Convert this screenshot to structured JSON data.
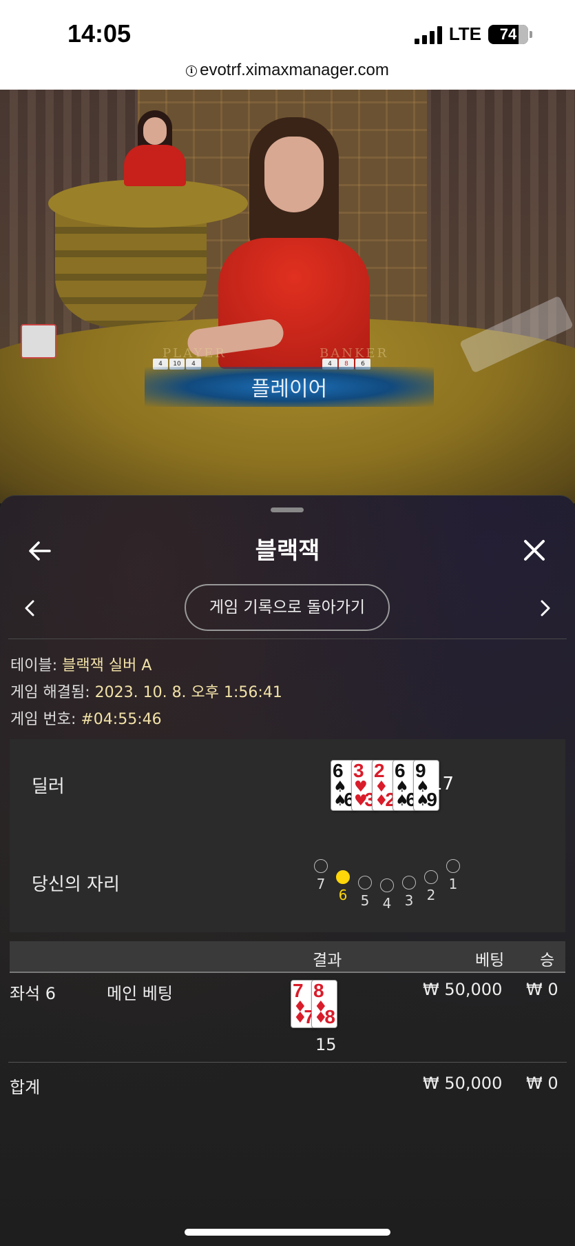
{
  "status_bar": {
    "time": "14:05",
    "network": "LTE",
    "battery": "74"
  },
  "browser": {
    "url": "evotrf.ximaxmanager.com"
  },
  "video": {
    "player_label": "PLAYER",
    "banker_label": "BANKER",
    "result_banner": "플레이어"
  },
  "panel": {
    "title": "블랙잭",
    "history_button": "게임 기록으로 돌아가기",
    "info": {
      "table_label": "테이블: ",
      "table_value": "블랙잭 실버 A",
      "resolved_label": "게임 해결됨: ",
      "resolved_value": "2023. 10. 8. 오후 1:56:41",
      "game_no_label": "게임 번호: ",
      "game_no_value": "#04:55:46"
    },
    "dealer": {
      "label": "딜러",
      "cards": [
        {
          "rank": "6",
          "suit": "♠",
          "color": "black"
        },
        {
          "rank": "3",
          "suit": "♥",
          "color": "red"
        },
        {
          "rank": "2",
          "suit": "♦",
          "color": "red"
        },
        {
          "rank": "6",
          "suit": "♠",
          "color": "black"
        },
        {
          "rank": "9",
          "suit": "♠",
          "color": "black"
        }
      ],
      "total": "17"
    },
    "seats": {
      "label": "당신의 자리",
      "items": [
        {
          "num": "7",
          "active": false
        },
        {
          "num": "6",
          "active": true
        },
        {
          "num": "5",
          "active": false
        },
        {
          "num": "4",
          "active": false
        },
        {
          "num": "3",
          "active": false
        },
        {
          "num": "2",
          "active": false
        },
        {
          "num": "1",
          "active": false
        }
      ]
    },
    "bets_table": {
      "headers": {
        "result": "결과",
        "bet": "베팅",
        "win": "승"
      },
      "row": {
        "seat": "좌석 6",
        "type": "메인 베팅",
        "cards": [
          {
            "rank": "7",
            "suit": "♦",
            "color": "red"
          },
          {
            "rank": "8",
            "suit": "♦",
            "color": "red"
          }
        ],
        "hand_total": "15",
        "bet": "₩ 50,000",
        "win": "₩ 0"
      },
      "total": {
        "label": "합계",
        "bet": "₩ 50,000",
        "win": "₩ 0"
      }
    }
  }
}
